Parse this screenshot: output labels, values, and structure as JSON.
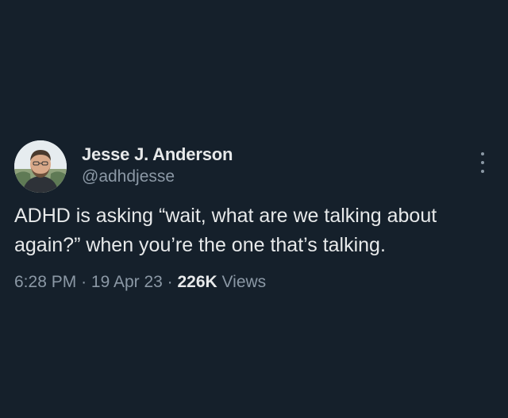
{
  "author": {
    "display_name": "Jesse J. Anderson",
    "handle": "@adhdjesse",
    "avatar_icon": "profile-photo"
  },
  "tweet": {
    "text": "ADHD is asking “wait, what are we talking about again?” when you’re the one that’s talking."
  },
  "meta": {
    "time": "6:28 PM",
    "separator": "·",
    "date": "19 Apr 23",
    "views_count": "226K",
    "views_label": "Views"
  },
  "icons": {
    "more": "more-options-icon"
  },
  "colors": {
    "background": "#15202b",
    "primary_text": "#e7e9ea",
    "secondary_text": "#8b98a5"
  }
}
